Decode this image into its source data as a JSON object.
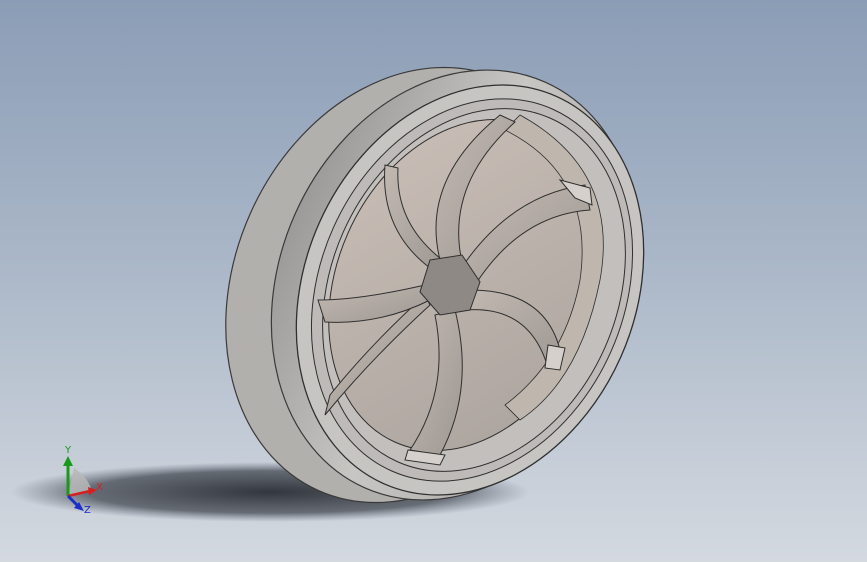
{
  "viewport": {
    "background_top": "#8b9db6",
    "background_bottom": "#d4d9e0"
  },
  "model": {
    "type": "wheel",
    "spoke_count": 6,
    "body_color": "#c9c6c3"
  },
  "triad": {
    "x_label": "X",
    "y_label": "Y",
    "z_label": "Z",
    "x_color": "#d42020",
    "y_color": "#1a9a1a",
    "z_color": "#1a2fc8"
  }
}
